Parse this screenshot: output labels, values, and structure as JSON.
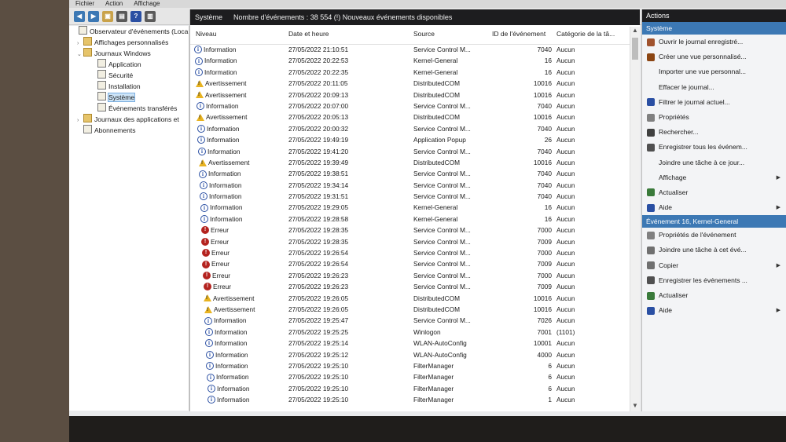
{
  "menubar": {
    "items": [
      "Fichier",
      "Action",
      "Affichage"
    ]
  },
  "tree": {
    "items": [
      {
        "label": "Observateur d'événements (Loca",
        "level": 0,
        "icon": "viewer-icon",
        "expanded": true
      },
      {
        "label": "Affichages personnalisés",
        "level": 1,
        "icon": "folder-icon",
        "arrow": "›"
      },
      {
        "label": "Journaux Windows",
        "level": 1,
        "icon": "folder-icon",
        "arrow": "⌄"
      },
      {
        "label": "Application",
        "level": 2,
        "icon": "log-icon"
      },
      {
        "label": "Sécurité",
        "level": 2,
        "icon": "log-icon"
      },
      {
        "label": "Installation",
        "level": 2,
        "icon": "log-icon"
      },
      {
        "label": "Système",
        "level": 2,
        "icon": "log-icon",
        "selected": true
      },
      {
        "label": "Événements transférés",
        "level": 2,
        "icon": "log-icon"
      },
      {
        "label": "Journaux des applications et",
        "level": 1,
        "icon": "folder-icon",
        "arrow": "›"
      },
      {
        "label": "Abonnements",
        "level": 1,
        "icon": "subscription-icon"
      }
    ]
  },
  "center": {
    "title": "Système",
    "count_text": "Nombre d'événements : 38 554 (!) Nouveaux événements disponibles",
    "columns": {
      "level": "Niveau",
      "date": "Date et heure",
      "source": "Source",
      "id": "ID de l'événement",
      "category": "Catégorie de la tâ..."
    },
    "rows": [
      {
        "level": "Information",
        "type": "info",
        "date": "27/05/2022 21:10:51",
        "source": "Service Control M...",
        "id": "7040",
        "category": "Aucun"
      },
      {
        "level": "Information",
        "type": "info",
        "date": "27/05/2022 20:22:53",
        "source": "Kernel-General",
        "id": "16",
        "category": "Aucun"
      },
      {
        "level": "Information",
        "type": "info",
        "date": "27/05/2022 20:22:35",
        "source": "Kernel-General",
        "id": "16",
        "category": "Aucun"
      },
      {
        "level": "Avertissement",
        "type": "warn",
        "date": "27/05/2022 20:11:05",
        "source": "DistributedCOM",
        "id": "10016",
        "category": "Aucun"
      },
      {
        "level": "Avertissement",
        "type": "warn",
        "date": "27/05/2022 20:09:13",
        "source": "DistributedCOM",
        "id": "10016",
        "category": "Aucun"
      },
      {
        "level": "Information",
        "type": "info",
        "date": "27/05/2022 20:07:00",
        "source": "Service Control M...",
        "id": "7040",
        "category": "Aucun"
      },
      {
        "level": "Avertissement",
        "type": "warn",
        "date": "27/05/2022 20:05:13",
        "source": "DistributedCOM",
        "id": "10016",
        "category": "Aucun"
      },
      {
        "level": "Information",
        "type": "info",
        "date": "27/05/2022 20:00:32",
        "source": "Service Control M...",
        "id": "7040",
        "category": "Aucun"
      },
      {
        "level": "Information",
        "type": "info",
        "date": "27/05/2022 19:49:19",
        "source": "Application Popup",
        "id": "26",
        "category": "Aucun"
      },
      {
        "level": "Information",
        "type": "info",
        "date": "27/05/2022 19:41:20",
        "source": "Service Control M...",
        "id": "7040",
        "category": "Aucun"
      },
      {
        "level": "Avertissement",
        "type": "warn",
        "date": "27/05/2022 19:39:49",
        "source": "DistributedCOM",
        "id": "10016",
        "category": "Aucun"
      },
      {
        "level": "Information",
        "type": "info",
        "date": "27/05/2022 19:38:51",
        "source": "Service Control M...",
        "id": "7040",
        "category": "Aucun"
      },
      {
        "level": "Information",
        "type": "info",
        "date": "27/05/2022 19:34:14",
        "source": "Service Control M...",
        "id": "7040",
        "category": "Aucun"
      },
      {
        "level": "Information",
        "type": "info",
        "date": "27/05/2022 19:31:51",
        "source": "Service Control M...",
        "id": "7040",
        "category": "Aucun"
      },
      {
        "level": "Information",
        "type": "info",
        "date": "27/05/2022 19:29:05",
        "source": "Kernel-General",
        "id": "16",
        "category": "Aucun"
      },
      {
        "level": "Information",
        "type": "info",
        "date": "27/05/2022 19:28:58",
        "source": "Kernel-General",
        "id": "16",
        "category": "Aucun"
      },
      {
        "level": "Erreur",
        "type": "err",
        "date": "27/05/2022 19:28:35",
        "source": "Service Control M...",
        "id": "7000",
        "category": "Aucun"
      },
      {
        "level": "Erreur",
        "type": "err",
        "date": "27/05/2022 19:28:35",
        "source": "Service Control M...",
        "id": "7009",
        "category": "Aucun"
      },
      {
        "level": "Erreur",
        "type": "err",
        "date": "27/05/2022 19:26:54",
        "source": "Service Control M...",
        "id": "7000",
        "category": "Aucun"
      },
      {
        "level": "Erreur",
        "type": "err",
        "date": "27/05/2022 19:26:54",
        "source": "Service Control M...",
        "id": "7009",
        "category": "Aucun"
      },
      {
        "level": "Erreur",
        "type": "err",
        "date": "27/05/2022 19:26:23",
        "source": "Service Control M...",
        "id": "7000",
        "category": "Aucun"
      },
      {
        "level": "Erreur",
        "type": "err",
        "date": "27/05/2022 19:26:23",
        "source": "Service Control M...",
        "id": "7009",
        "category": "Aucun"
      },
      {
        "level": "Avertissement",
        "type": "warn",
        "date": "27/05/2022 19:26:05",
        "source": "DistributedCOM",
        "id": "10016",
        "category": "Aucun"
      },
      {
        "level": "Avertissement",
        "type": "warn",
        "date": "27/05/2022 19:26:05",
        "source": "DistributedCOM",
        "id": "10016",
        "category": "Aucun"
      },
      {
        "level": "Information",
        "type": "info",
        "date": "27/05/2022 19:25:47",
        "source": "Service Control M...",
        "id": "7026",
        "category": "Aucun"
      },
      {
        "level": "Information",
        "type": "info",
        "date": "27/05/2022 19:25:25",
        "source": "Winlogon",
        "id": "7001",
        "category": "(1101)"
      },
      {
        "level": "Information",
        "type": "info",
        "date": "27/05/2022 19:25:14",
        "source": "WLAN-AutoConfig",
        "id": "10001",
        "category": "Aucun"
      },
      {
        "level": "Information",
        "type": "info",
        "date": "27/05/2022 19:25:12",
        "source": "WLAN-AutoConfig",
        "id": "4000",
        "category": "Aucun"
      },
      {
        "level": "Information",
        "type": "info",
        "date": "27/05/2022 19:25:10",
        "source": "FilterManager",
        "id": "6",
        "category": "Aucun"
      },
      {
        "level": "Information",
        "type": "info",
        "date": "27/05/2022 19:25:10",
        "source": "FilterManager",
        "id": "6",
        "category": "Aucun"
      },
      {
        "level": "Information",
        "type": "info",
        "date": "27/05/2022 19:25:10",
        "source": "FilterManager",
        "id": "6",
        "category": "Aucun"
      },
      {
        "level": "Information",
        "type": "info",
        "date": "27/05/2022 19:25:10",
        "source": "FilterManager",
        "id": "1",
        "category": "Aucun"
      }
    ]
  },
  "actions": {
    "title": "Actions",
    "section1": "Système",
    "items1": [
      {
        "label": "Ouvrir le journal enregistré...",
        "icon": "open-log-icon",
        "color": "#a0522d"
      },
      {
        "label": "Créer une vue personnalisé...",
        "icon": "filter-icon",
        "color": "#8b4513"
      },
      {
        "label": "Importer une vue personnal...",
        "icon": "blank",
        "color": ""
      },
      {
        "label": "Effacer le journal...",
        "icon": "blank",
        "color": ""
      },
      {
        "label": "Filtrer le journal actuel...",
        "icon": "filter-icon",
        "color": "#2a4fa3"
      },
      {
        "label": "Propriétés",
        "icon": "properties-icon",
        "color": "#808080"
      },
      {
        "label": "Rechercher...",
        "icon": "find-icon",
        "color": "#404040"
      },
      {
        "label": "Enregistrer tous les événem...",
        "icon": "save-icon",
        "color": "#505050"
      },
      {
        "label": "Joindre une tâche à ce jour...",
        "icon": "blank",
        "color": ""
      },
      {
        "label": "Affichage",
        "icon": "blank",
        "color": "",
        "submenu": true
      },
      {
        "label": "Actualiser",
        "icon": "refresh-icon",
        "color": "#3a7a3a"
      },
      {
        "label": "Aide",
        "icon": "help-icon",
        "color": "#2a4fa3",
        "submenu": true
      }
    ],
    "section2": "Événement 16, Kernel-General",
    "items2": [
      {
        "label": "Propriétés de l'événement",
        "icon": "properties-icon",
        "color": "#808080"
      },
      {
        "label": "Joindre une tâche à cet évé...",
        "icon": "task-icon",
        "color": "#707070"
      },
      {
        "label": "Copier",
        "icon": "copy-icon",
        "color": "#707070",
        "submenu": true
      },
      {
        "label": "Enregistrer les événements ...",
        "icon": "save-icon",
        "color": "#505050"
      },
      {
        "label": "Actualiser",
        "icon": "refresh-icon",
        "color": "#3a7a3a"
      },
      {
        "label": "Aide",
        "icon": "help-icon",
        "color": "#2a4fa3",
        "submenu": true
      }
    ]
  },
  "colors": {
    "header_bg": "#1d1d1f",
    "section_bg": "#3c78b4",
    "error": "#b4231f",
    "warning": "#e8b320",
    "info": "#2a4fa3"
  }
}
